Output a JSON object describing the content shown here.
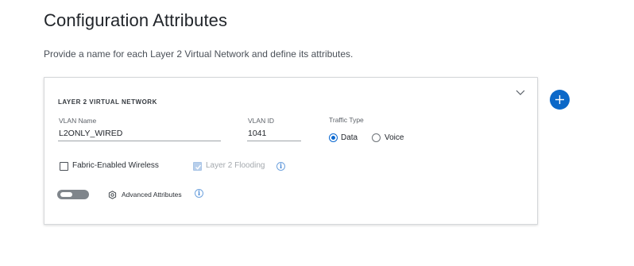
{
  "header": {
    "title": "Configuration Attributes",
    "subtitle": "Provide a name for each Layer 2 Virtual Network and define its attributes."
  },
  "card": {
    "heading": "LAYER 2 VIRTUAL NETWORK",
    "collapse_icon": "chevron-down-icon",
    "vlan_name": {
      "label": "VLAN Name",
      "value": "L2ONLY_WIRED"
    },
    "vlan_id": {
      "label": "VLAN ID",
      "value": "1041"
    },
    "traffic_type": {
      "label": "Traffic Type",
      "options": [
        {
          "label": "Data",
          "selected": true
        },
        {
          "label": "Voice",
          "selected": false
        }
      ]
    },
    "fabric_enabled_wireless": {
      "label": "Fabric-Enabled Wireless",
      "checked": false
    },
    "layer2_flooding": {
      "label": "Layer 2 Flooding",
      "checked": true,
      "disabled": true
    },
    "advanced_attributes": {
      "label": "Advanced Attributes",
      "toggle_on": false
    },
    "info_icon": "info-icon"
  },
  "add_button": {
    "icon": "plus-icon"
  },
  "colors": {
    "accent": "#0a68d0",
    "add_button": "#0b68c8",
    "toggle_off": "#7f858b",
    "disabled_text": "#a4a9ae"
  }
}
